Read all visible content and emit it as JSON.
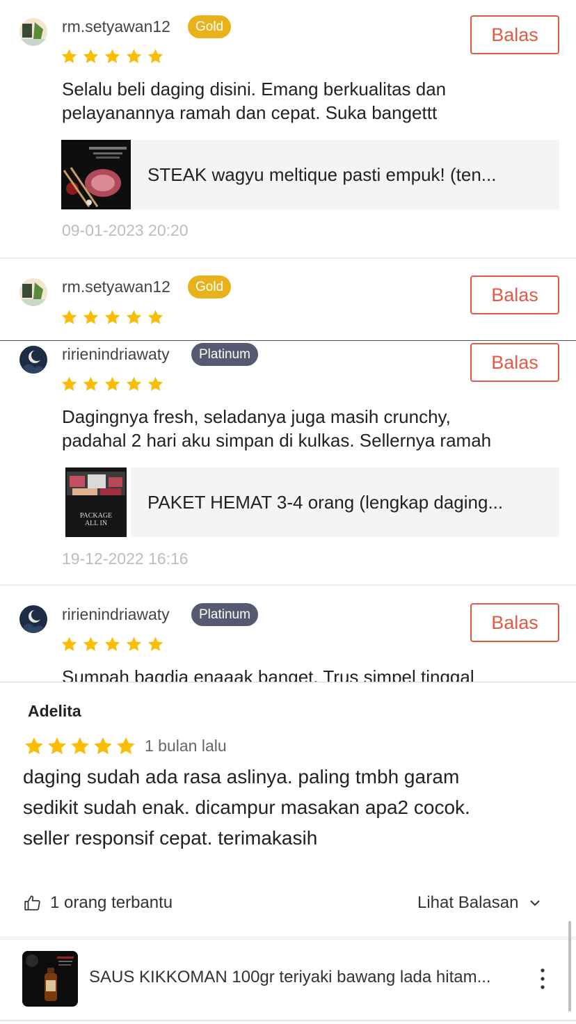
{
  "reviews": [
    {
      "username": "rm.setyawan12",
      "badge": "Gold",
      "reply_label": "Balas",
      "rating": 5,
      "text_lines": [
        "Selalu beli daging disini. Emang berkualitas dan",
        "pelayanannya ramah dan cepat. Suka bangettt"
      ],
      "product_name": "STEAK wagyu meltique pasti empuk! (ten...",
      "timestamp": "09-01-2023 20:20"
    },
    {
      "username": "rm.setyawan12",
      "badge": "Gold",
      "reply_label": "Balas",
      "rating": 5
    },
    {
      "username": "ririenindriawaty",
      "badge": "Platinum",
      "reply_label": "Balas",
      "rating": 5,
      "text_lines": [
        "Dagingnya fresh, seladanya juga masih crunchy,",
        "padahal 2 hari aku simpan di kulkas. Sellernya ramah"
      ],
      "product_name": "PAKET HEMAT 3-4 orang (lengkap daging...",
      "product_thumb_text": [
        "PACKAGE",
        "ALL IN"
      ],
      "timestamp": "19-12-2022 16:16"
    },
    {
      "username": "ririenindriawaty",
      "badge": "Platinum",
      "reply_label": "Balas",
      "rating": 5,
      "text_lines": [
        "Sumpah bagdia enaaak banget. Trus simpel tinggal"
      ]
    }
  ],
  "panel": {
    "username": "Adelita",
    "rating": 5,
    "time": "1 bulan lalu",
    "text_lines": [
      "daging sudah ada rasa aslinya. paling tmbh garam",
      "sedikit sudah enak. dicampur masakan apa2 cocok.",
      "seller responsif cepat. terimakasih"
    ],
    "helpful_label": "1 orang terbantu",
    "see_reply_label": "Lihat Balasan",
    "product_name": "SAUS KIKKOMAN 100gr teriyaki bawang lada hitam..."
  },
  "colors": {
    "accent": "#e25a44",
    "star": "#fbbc05",
    "gold_badge": "#e9b21b",
    "platinum_badge": "#555a70",
    "timestamp": "#bdbdbd"
  },
  "icons": [
    "star-icon",
    "thumbs-up-icon",
    "chevron-down-icon",
    "more-vertical-icon"
  ]
}
